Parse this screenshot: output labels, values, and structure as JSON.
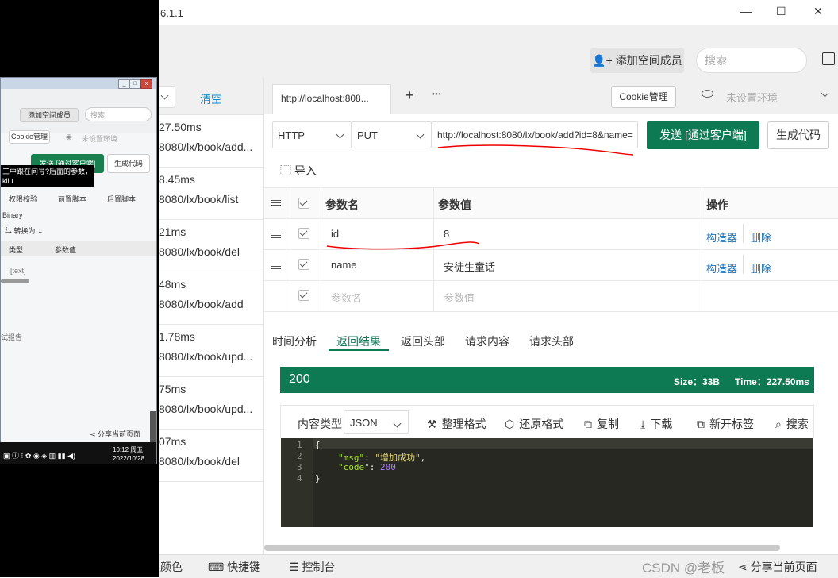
{
  "window": {
    "title_fragment": "6.1.1",
    "minimize": "—",
    "maximize": "☐",
    "close": "✕"
  },
  "header": {
    "add_member": "添加空间成员",
    "search_placeholder": "搜索"
  },
  "history": {
    "clear_label": "清空",
    "items": [
      {
        "time": "27.50ms",
        "url": "8080/lx/book/add..."
      },
      {
        "time": "8.45ms",
        "url": "8080/lx/book/list"
      },
      {
        "time": "21ms",
        "url": "8080/lx/book/del"
      },
      {
        "time": "48ms",
        "url": "8080/lx/book/add"
      },
      {
        "time": "1.78ms",
        "url": "8080/lx/book/upd..."
      },
      {
        "time": "75ms",
        "url": "8080/lx/book/upd..."
      },
      {
        "time": "07ms",
        "url": "8080/lx/book/del"
      }
    ]
  },
  "tabs": {
    "active": "http://localhost:808...",
    "add": "+",
    "more": "•••",
    "cookie": "Cookie管理",
    "env": "未设置环境"
  },
  "request": {
    "protocol": "HTTP",
    "method": "PUT",
    "url": "http://localhost:8080/lx/book/add?id=8&name=",
    "send": "发送 [通过客户端]",
    "gen_code": "生成代码",
    "import": "导入"
  },
  "params": {
    "headers": {
      "name": "参数名",
      "value": "参数值",
      "ops": "操作"
    },
    "rows": [
      {
        "name": "id",
        "value": "8",
        "builder": "构造器",
        "delete": "删除"
      },
      {
        "name": "name",
        "value": "安徒生童话",
        "builder": "构造器",
        "delete": "删除"
      }
    ],
    "placeholder": {
      "name": "参数名",
      "value": "参数值"
    }
  },
  "response_tabs": [
    "时间分析",
    "返回结果",
    "返回头部",
    "请求内容",
    "请求头部"
  ],
  "status": {
    "code": "200",
    "size": "Size：33B",
    "time": "Time：227.50ms",
    "color": "#0d7a53"
  },
  "toolbar": {
    "content_type_label": "内容类型",
    "content_type": "JSON",
    "format": "整理格式",
    "restore": "还原格式",
    "copy": "复制",
    "download": "下载",
    "new_tab": "新开标签",
    "search": "搜索"
  },
  "code": {
    "lines": [
      "1",
      "2",
      "3",
      "4"
    ],
    "open": "{",
    "k1": "\"msg\"",
    "v1": "\"增加成功\"",
    "k2": "\"code\"",
    "v2": "200",
    "close": "}"
  },
  "bottom": {
    "color": "颜色",
    "shortcut": "快捷键",
    "console": "控制台",
    "share": "分享当前页面",
    "watermark": "CSDN @老板"
  },
  "mini": {
    "add_member": "添加空间成员",
    "search": "搜索",
    "cookie": "Cookie管理",
    "env": "未设置环境",
    "send": "发送 [通过客户端]",
    "gen": "生成代码",
    "tooltip1": "三中跟在问号?后面的参数，",
    "tooltip2": "kliu",
    "auth": "权限校验",
    "pre": "前置脚本",
    "post": "后置脚本",
    "binary": "Binary",
    "convert": "转换为",
    "type": "类型",
    "value": "参数值",
    "text": "[text]",
    "report": "试报告",
    "share": "分享当前页面",
    "clock_time": "10:12 周五",
    "clock_date": "2022/10/28"
  }
}
